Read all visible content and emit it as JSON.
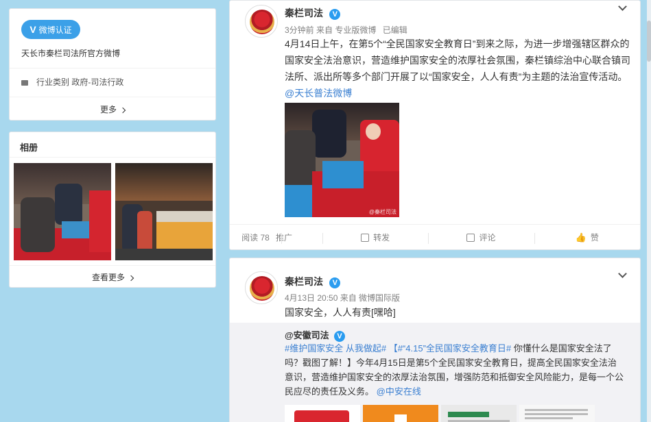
{
  "profile_card": {
    "verify_badge": "微博认证",
    "description": "天长市秦栏司法所官方微博",
    "category_label": "行业类别",
    "category_value": "政府-司法行政",
    "more": "更多"
  },
  "album_card": {
    "title": "相册",
    "view_more": "查看更多"
  },
  "posts": [
    {
      "author": "秦栏司法",
      "meta": "3分钟前 来自 专业版微博",
      "edited": "已编辑",
      "text": "4月14日上午，在第5个“全民国家安全教育日”到来之际，为进一步增强辖区群众的国家安全法治意识，营造维护国家安全的浓厚社会氛围，秦栏镇综治中心联合镇司法所、派出所等多个部门开展了以“国家安全，人人有责”为主题的法治宣传活动。",
      "mention": "@天长普法微博",
      "image_watermark": "@秦栏司法",
      "footer": {
        "reads": "阅读 78",
        "promote": "推广",
        "repost": "转发",
        "comment": "评论",
        "like": "赞"
      }
    },
    {
      "author": "秦栏司法",
      "meta": "4月13日 20:50 来自 微博国际版",
      "text": "国家安全，人人有责[嘿哈]",
      "repost": {
        "author": "@安徽司法",
        "tags": "#维护国家安全 从我做起#",
        "topic": "【#“4.15”全民国家安全教育日#",
        "body": "你懂什么是国家安全法了吗？戳图了解！】今年4月15日是第5个全民国家安全教育日，提高全民国家安全法治意识，营造维护国家安全的浓厚法治氛围，增强防范和抵御安全风险能力，是每一个公民应尽的责任及义务。",
        "mention": "@中安在线"
      }
    }
  ],
  "colors": {
    "background": "#a8d8ee",
    "accent_orange": "#eb7350",
    "link_blue": "#3a7fd1",
    "badge_blue": "#2a9cf0"
  }
}
